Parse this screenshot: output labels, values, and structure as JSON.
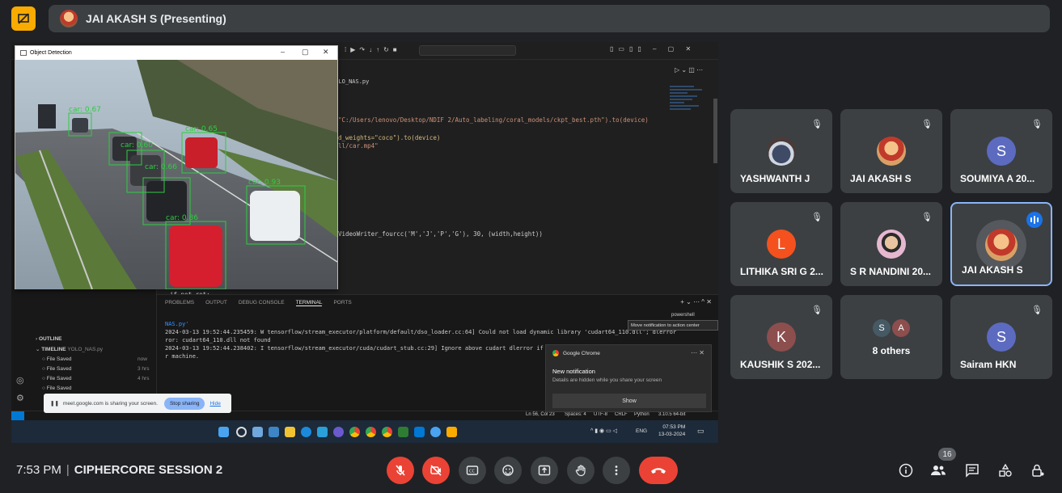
{
  "topbar": {
    "presenter_name": "JAI AKASH S (Presenting)"
  },
  "shared_screen": {
    "detection_window": {
      "title": "Object Detection",
      "detections": [
        "car: 0.67",
        "car: 0.65",
        "car: 0.66",
        "car: 0.60",
        "car: 0.93",
        "car: 0.86"
      ]
    },
    "ide": {
      "tab": "YOLO_NAS.py",
      "code_lines": [
        "\"C:/Users/lenovo/Desktop/NDIF 2/Auto_labeling/coral_models/ckpt_best.pth\").to(device)",
        "d_weights=\"coco\").to(device)",
        "ll/car.mp4\"",
        "VideoWriter_fourcc('M','J','P','G'), 30, (width,height))",
        "if not ret:"
      ],
      "panel_tabs": [
        "PROBLEMS",
        "OUTPUT",
        "DEBUG CONSOLE",
        "TERMINAL",
        "PORTS"
      ],
      "terminal_lines": [
        "NAS.py'",
        "2024-03-13 19:52:44.235459: W tensorflow/stream_executor/platform/default/dso_loader.cc:64] Could not load dynamic library 'cudart64_110.dll'; dlerror",
        "ror: cudart64_110.dll not found",
        "2024-03-13 19:52:44.238402: I tensorflow/stream_executor/cuda/cudart_stub.cc:29] Ignore above cudart dlerror if yo",
        "r machine."
      ],
      "outline_label": "OUTLINE",
      "timeline_label": "TIMELINE",
      "timeline_file": "YOLO_NAS.py",
      "timeline_rows": [
        {
          "label": "File Saved",
          "time": "now"
        },
        {
          "label": "File Saved",
          "time": "3 hrs"
        },
        {
          "label": "File Saved",
          "time": "4 hrs"
        },
        {
          "label": "File Saved",
          "time": ""
        }
      ],
      "terminal_name": "powershell",
      "status_items": [
        "Ln 56, Col 23",
        "Spaces: 4",
        "UTF-8",
        "CRLF",
        "Python",
        "3.10.5 64-bit"
      ]
    },
    "tooltip": "Move notification to action center",
    "notification": {
      "app": "Google Chrome",
      "title": "New notification",
      "description": "Details are hidden while you share your screen",
      "button": "Show"
    },
    "share_bar": {
      "text": "meet.google.com is sharing your screen.",
      "stop_label": "Stop sharing",
      "hide_label": "Hide"
    },
    "taskbar": {
      "tray": "ENG",
      "time": "07:53 PM",
      "date": "13-03-2024"
    }
  },
  "participants": [
    {
      "name": "YASHWANTH J",
      "avatar_type": "photo",
      "muted": true
    },
    {
      "name": "JAI AKASH S",
      "avatar_type": "photo",
      "muted": true
    },
    {
      "name": "SOUMIYA A 20...",
      "initial": "S",
      "color": "#5c6bc0",
      "muted": true
    },
    {
      "name": "LITHIKA SRI G 2...",
      "initial": "L",
      "color": "#f4511e",
      "muted": true
    },
    {
      "name": "S R NANDINI 20...",
      "avatar_type": "photo",
      "muted": true
    },
    {
      "name": "JAI AKASH S",
      "avatar_type": "photo",
      "speaking": true
    },
    {
      "name": "KAUSHIK S 202...",
      "initial": "K",
      "color": "#8d4e4e",
      "muted": true
    },
    {
      "name": "8 others",
      "initials": [
        "S",
        "A"
      ],
      "colors": [
        "#455a64",
        "#8d4e4e"
      ]
    },
    {
      "name": "Sairam HKN",
      "initial": "S",
      "color": "#5c6bc0",
      "muted": true
    }
  ],
  "bottom": {
    "time": "7:53 PM",
    "meeting_name": "CIPHERCORE SESSION 2",
    "participant_count": "16",
    "controls": [
      "mic-off",
      "camera-off",
      "captions",
      "emoji",
      "present",
      "raise-hand",
      "more",
      "leave-call"
    ],
    "right_icons": [
      "info",
      "people",
      "chat",
      "activities",
      "host-controls"
    ]
  },
  "colors": {
    "background": "#202124",
    "tile": "#3c4043",
    "danger": "#ea4335",
    "accent": "#8ab4f8",
    "present_badge": "#f9ab00"
  }
}
